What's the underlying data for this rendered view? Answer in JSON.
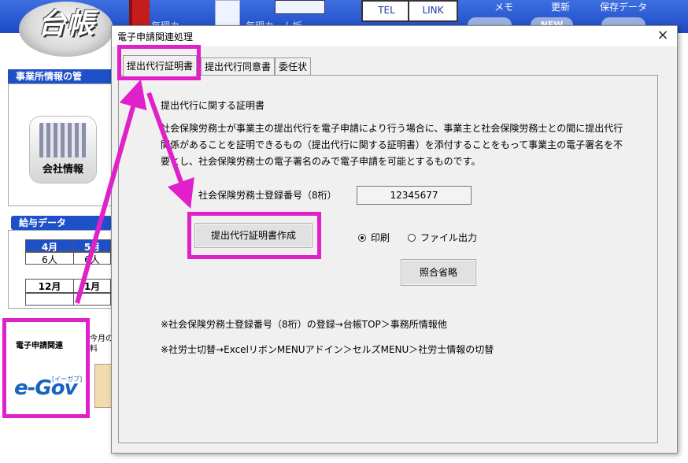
{
  "background_app": {
    "logo_text": "台帳",
    "top_labels": [
      "毎理カ...",
      "毎理カ...ム板"
    ],
    "tel_button": "TEL",
    "link_button": "LINK",
    "memo_label": "メモ",
    "update_label": "更新",
    "save_label": "保存データ",
    "new_badge": "NEW",
    "office_panel_title": "事業所情報の管",
    "company_label": "会社情報",
    "salary_panel_title": "給与データ",
    "salary_rows": [
      {
        "month_a": "4月",
        "month_b": "5月",
        "count_a": "6人",
        "count_b": "6人"
      },
      {
        "month_a": "12月",
        "month_b": "1月"
      }
    ],
    "egov_title": "電子申請関連",
    "egov_logo": "e-Gov",
    "egov_sub": "[イーガブ]",
    "next_tile_text": "今月の\n料"
  },
  "dialog": {
    "title": "電子申請関連処理",
    "close_label": "×",
    "tabs": [
      {
        "label": "提出代行証明書",
        "active": true
      },
      {
        "label": "提出代行同意書",
        "active": false
      },
      {
        "label": "委任状",
        "active": false
      }
    ],
    "heading": "提出代行に関する証明書",
    "description": "社会保険労務士が事業主の提出代行を電子申請により行う場合に、事業主と社会保険労務士との間に提出代行関係があることを証明できるもの（提出代行に関する証明書）を添付することをもって事業主の電子署名を不要とし、社会保険労務士の電子署名のみで電子申請を可能とするものです。",
    "reg_label": "社会保険労務士登録番号（8桁）",
    "reg_value": "12345677",
    "create_button": "提出代行証明書作成",
    "radio_print": "印刷",
    "radio_file": "ファイル出力",
    "radio_selected": "print",
    "skip_button": "照合省略",
    "note1": "※社会保険労務士登録番号（8桁）の登録→台帳TOP＞事務所情報他",
    "note2": "※社労士切替→ExcelリボンMENUアドイン＞セルズMENU＞社労士情報の切替"
  },
  "annotation_color": "#e020c8"
}
